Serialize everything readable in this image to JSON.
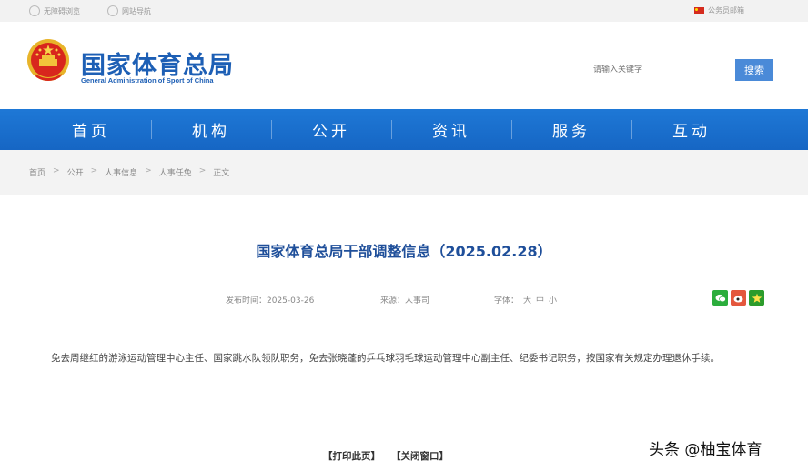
{
  "topbar": {
    "accessibility": "无障碍浏览",
    "site_nav": "网站导航",
    "email": "公务员邮箱"
  },
  "header": {
    "site_name": "国家体育总局",
    "site_name_en": "General Administration of Sport of China",
    "search_placeholder": "请输入关键字",
    "search_button": "搜索"
  },
  "nav": {
    "items": [
      {
        "label": "首页"
      },
      {
        "label": "机构"
      },
      {
        "label": "公开"
      },
      {
        "label": "资讯"
      },
      {
        "label": "服务"
      },
      {
        "label": "互动"
      }
    ]
  },
  "breadcrumb": [
    "首页",
    "公开",
    "人事信息",
    "人事任免",
    "正文"
  ],
  "article": {
    "title": "国家体育总局干部调整信息（2025.02.28）",
    "publish_date": "发布时间：2025-03-26",
    "source": "来源：人事司",
    "font_label": "字体：",
    "font_large": "大",
    "font_medium": "中",
    "font_small": "小",
    "body": "免去周继红的游泳运动管理中心主任、国家跳水队领队职务，免去张晓蓬的乒乓球羽毛球运动管理中心副主任、纪委书记职务，按国家有关规定办理退休手续。"
  },
  "footer": {
    "print": "【打印此页】",
    "close": "【关闭窗口】"
  },
  "watermark": "头条 @柚宝体育",
  "colors": {
    "brand_blue": "#1d5fb5",
    "nav_blue": "#1e78d6",
    "title_blue": "#1f4f9a"
  }
}
